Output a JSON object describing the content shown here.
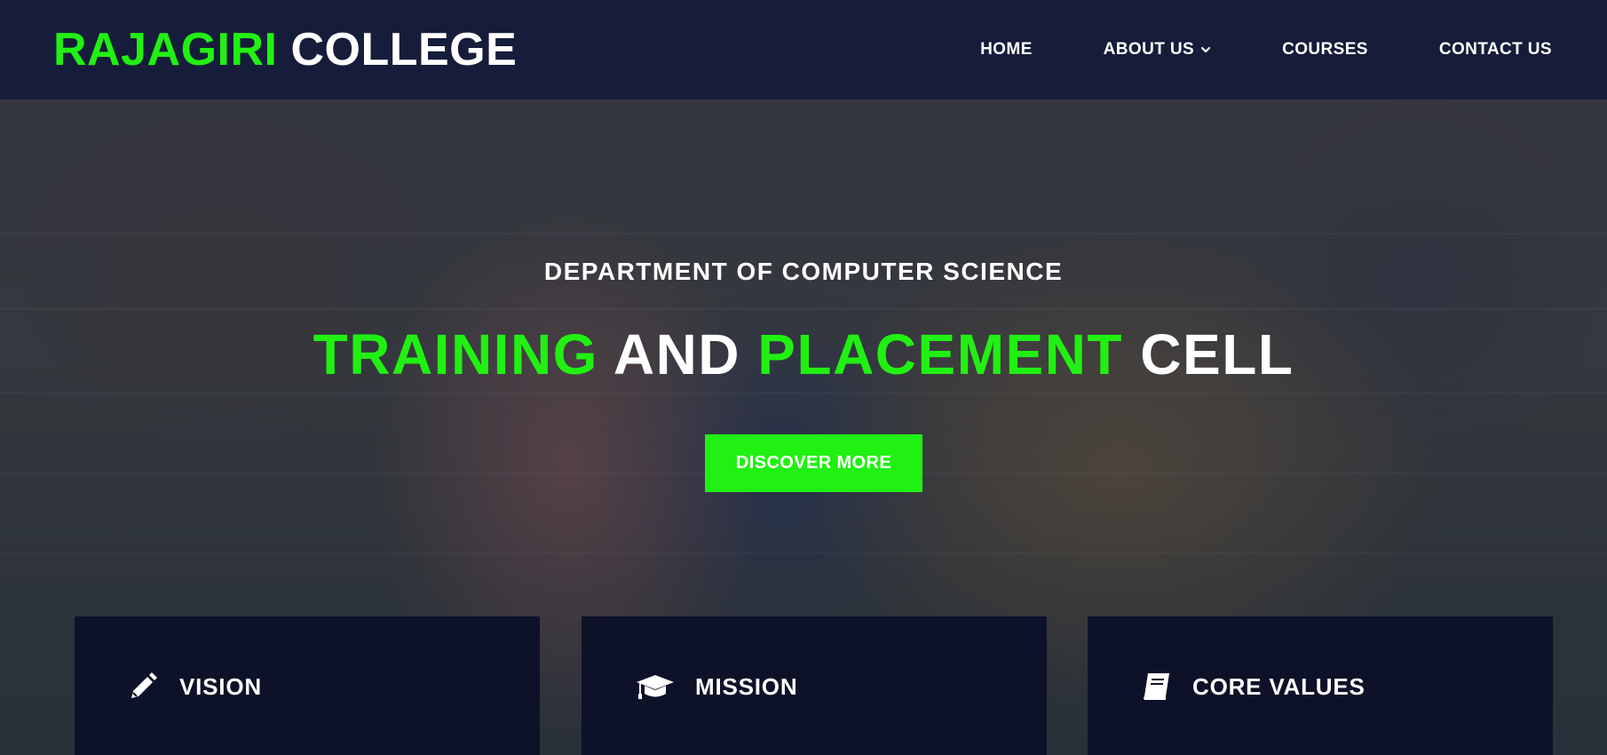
{
  "header": {
    "logo_part1": "RAJAGIRI",
    "logo_part2": "COLLEGE",
    "nav": {
      "home": "HOME",
      "about": "ABOUT US",
      "courses": "COURSES",
      "contact": "CONTACT US"
    }
  },
  "hero": {
    "subtitle": "DEPARTMENT OF COMPUTER SCIENCE",
    "title_word1": "TRAINING",
    "title_word2": "AND",
    "title_word3": "PLACEMENT",
    "title_word4": "CELL",
    "cta_label": "DISCOVER MORE"
  },
  "cards": [
    {
      "label": "VISION",
      "icon": "pencil-icon"
    },
    {
      "label": "MISSION",
      "icon": "graduation-cap-icon"
    },
    {
      "label": "CORE VALUES",
      "icon": "book-icon"
    }
  ],
  "colors": {
    "accent": "#21f013",
    "header_bg": "#161d3a",
    "card_bg": "#0d1228",
    "text": "#ffffff"
  }
}
